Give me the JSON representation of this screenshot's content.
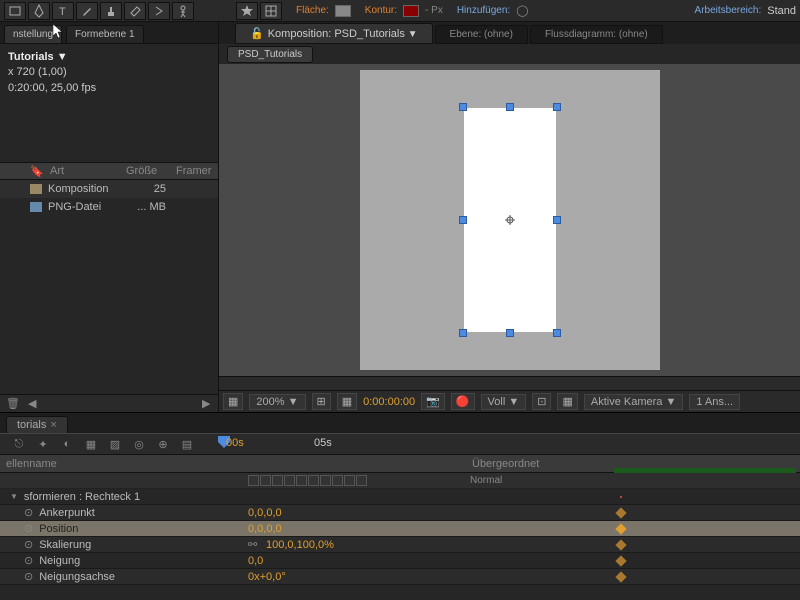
{
  "toolbar": {
    "flaeche": "Fläche:",
    "kontur": "Kontur:",
    "px": "- Px",
    "hinzufuegen": "Hinzufügen:",
    "arbeitsbereich": "Arbeitsbereich:",
    "standard": "Stand"
  },
  "project_panel": {
    "tab1": "nstellung",
    "tab2": "Formebene 1",
    "title": "Tutorials ▼",
    "res": "x 720 (1,00)",
    "dur": "0:20:00, 25,00 fps",
    "col_art": "Art",
    "col_groesse": "Größe",
    "col_framer": "Framer",
    "items": [
      {
        "art": "Komposition",
        "groesse": "25"
      },
      {
        "art": "PNG-Datei",
        "groesse": "... MB"
      }
    ]
  },
  "viewer": {
    "tab_comp": "Komposition: PSD_Tutorials",
    "tab_layer": "Ebene: (ohne)",
    "tab_flow": "Flussdiagramm: (ohne)",
    "subtab": "PSD_Tutorials",
    "zoom": "200%",
    "timecode": "0:00:00:00",
    "full": "Voll",
    "camera": "Aktive Kamera",
    "views": "1 Ans..."
  },
  "timeline": {
    "tab": "torials",
    "col_quelle": "ellenname",
    "col_ueber": "Übergeordnet",
    "mode": "Normal",
    "group": "sformieren : Rechteck 1",
    "time_05s": "05s",
    "time_00s": "00s",
    "props": [
      {
        "name": "Ankerpunkt",
        "value": "0,0,0,0"
      },
      {
        "name": "Position",
        "value": "0,0,0,0",
        "selected": true
      },
      {
        "name": "Skalierung",
        "value": "100,0,100,0%",
        "linked": true
      },
      {
        "name": "Neigung",
        "value": "0,0"
      },
      {
        "name": "Neigungsachse",
        "value": "0x+0,0°"
      }
    ]
  }
}
